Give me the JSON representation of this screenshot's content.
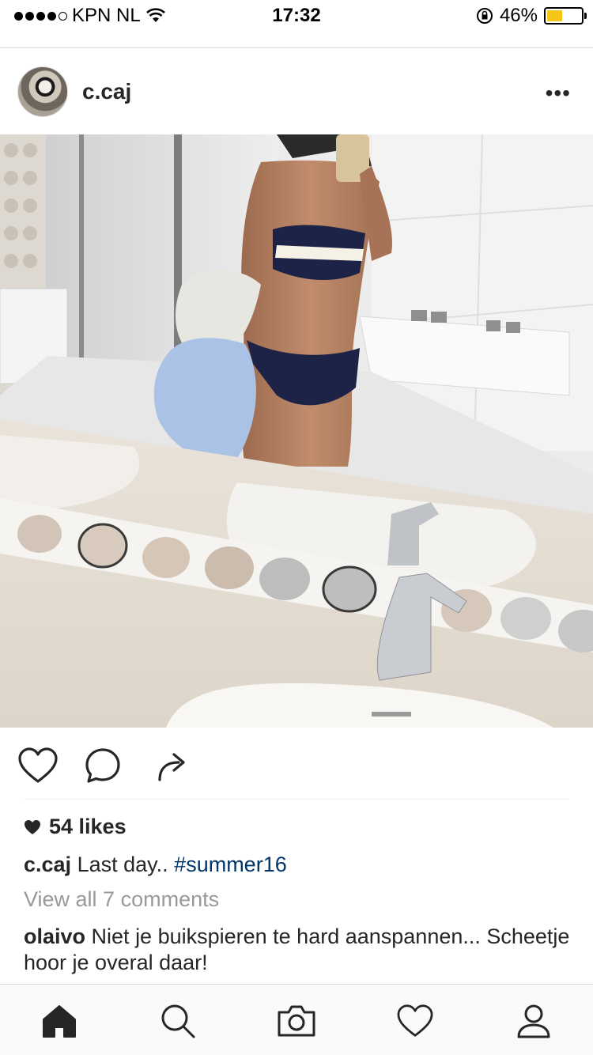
{
  "status_bar": {
    "carrier": "KPN NL",
    "time": "17:32",
    "battery_percent": "46%",
    "battery_level": 0.46,
    "signal_bars_filled": 4,
    "signal_bars_total": 5
  },
  "post": {
    "username": "c.caj",
    "more_label": "•••",
    "likes": "54 likes",
    "caption": {
      "user": "c.caj",
      "text": "Last day..",
      "hashtag": "#summer16"
    },
    "view_comments": "View all 7 comments",
    "comment": {
      "user": "olaivo",
      "text": "Niet je buikspieren te hard aanspannen... Scheetje hoor je overal daar!"
    }
  },
  "icons": {
    "like": "heart-icon",
    "comment": "comment-bubble-icon",
    "share": "share-arrow-icon",
    "tab_home": "home-icon",
    "tab_search": "search-icon",
    "tab_camera": "camera-icon",
    "tab_activity": "heart-icon",
    "tab_profile": "profile-icon"
  },
  "colors": {
    "hashtag": "#003569",
    "battery": "#f5c518",
    "muted_text": "#999999"
  }
}
